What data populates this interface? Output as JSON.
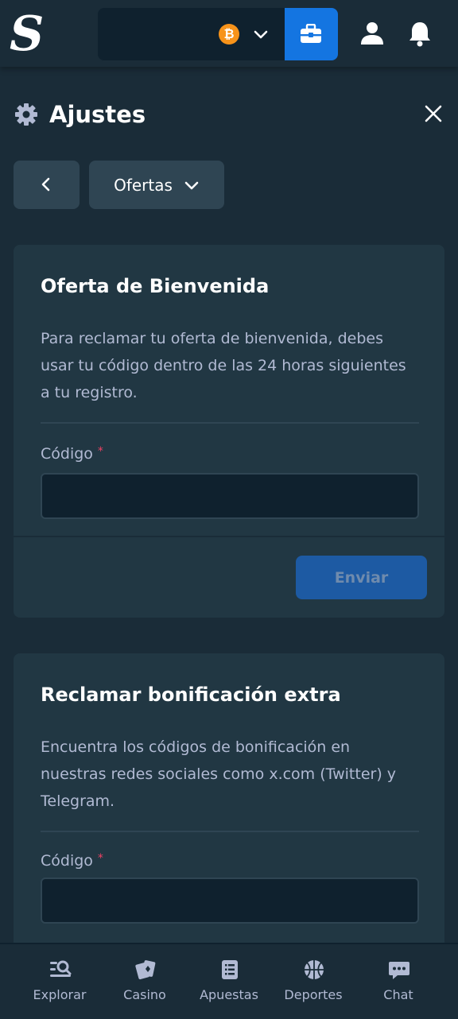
{
  "header": {
    "logo_letter": "S",
    "currency_icon": "bitcoin-icon",
    "currency_symbol": "₿",
    "wallet_icon": "wallet-icon",
    "profile_icon": "user-icon",
    "notifications_icon": "bell-icon"
  },
  "settings": {
    "title": "Ajustes",
    "icon": "gear-icon",
    "close_icon": "close-icon"
  },
  "nav": {
    "back_icon": "chevron-left-icon",
    "section_select": "Ofertas"
  },
  "welcome_offer": {
    "title": "Oferta de Bienvenida",
    "description": "Para reclamar tu oferta de bienvenida, debes usar tu código dentro de las 24 horas siguientes a tu registro.",
    "code_label": "Código",
    "required_mark": "*",
    "code_value": "",
    "submit_label": "Enviar"
  },
  "extra_bonus": {
    "title": "Reclamar bonificación extra",
    "description": "Encuentra los códigos de bonificación en nuestras redes sociales como x.com (Twitter) y Telegram.",
    "code_label": "Código",
    "required_mark": "*",
    "code_value": ""
  },
  "bottom_nav": {
    "items": [
      {
        "label": "Explorar",
        "icon": "explore-icon"
      },
      {
        "label": "Casino",
        "icon": "cards-icon"
      },
      {
        "label": "Apuestas",
        "icon": "betslip-icon"
      },
      {
        "label": "Deportes",
        "icon": "basketball-icon"
      },
      {
        "label": "Chat",
        "icon": "chat-icon"
      }
    ]
  },
  "colors": {
    "background": "#1a2c38",
    "card": "#213743",
    "input": "#0f212e",
    "accent": "#1475e1",
    "muted_text": "#b1bad3",
    "bitcoin": "#f7931a",
    "required": "#ed4163"
  }
}
